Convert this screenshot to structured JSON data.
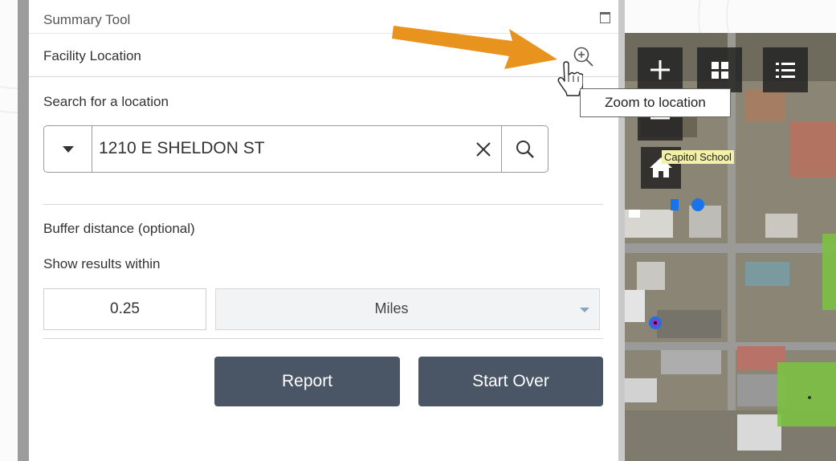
{
  "panel": {
    "title": "Summary Tool",
    "section_title": "Facility Location",
    "search_label": "Search for a location",
    "search_value": "1210 E SHELDON ST",
    "buffer_label": "Buffer distance (optional)",
    "within_label": "Show results within",
    "distance_value": "0.25",
    "units_selected": "Miles",
    "report_label": "Report",
    "start_over_label": "Start Over"
  },
  "tooltip": {
    "text": "Zoom to location"
  },
  "map": {
    "place_label": "Capitol School"
  },
  "colors": {
    "button_bg": "#4a5566",
    "arrow": "#e8931e",
    "tooltip_border": "#666666",
    "map_label_bg": "#f3f1a8",
    "park_green": "#7cc043"
  },
  "icons": [
    "maximize-icon",
    "zoom-to-location-icon",
    "chevron-down-icon",
    "clear-icon",
    "search-icon",
    "pointer-hand-icon",
    "plus-icon",
    "minus-icon",
    "grid-icon",
    "list-icon",
    "home-icon"
  ]
}
